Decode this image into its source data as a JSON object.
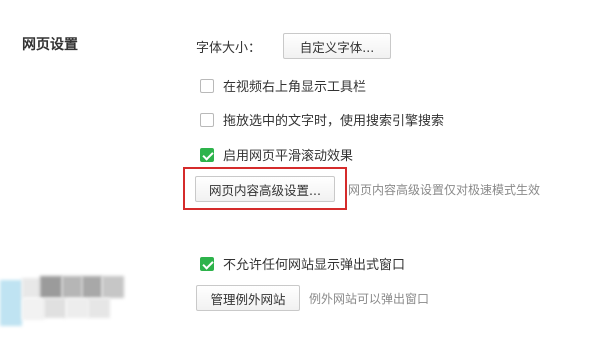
{
  "section": {
    "title": "网页设置"
  },
  "font_size": {
    "label": "字体大小：",
    "button_label": "自定义字体..."
  },
  "options": [
    {
      "label": "在视频右上角显示工具栏",
      "checked": false
    },
    {
      "label": "拖放选中的文字时，使用搜索引擎搜索",
      "checked": false
    },
    {
      "label": "启用网页平滑滚动效果",
      "checked": true
    }
  ],
  "advanced": {
    "button_label": "网页内容高级设置...",
    "hint": "网页内容高级设置仅对极速模式生效"
  },
  "popup": {
    "label": "不允许任何网站显示弹出式窗口",
    "checked": true
  },
  "exceptions": {
    "button_label": "管理例外网站",
    "hint": "例外网站可以弹出窗口"
  },
  "colors": {
    "checkbox_checked": "#2db34b",
    "highlight": "#d52b2b",
    "hint_text": "#8a8a8a"
  }
}
